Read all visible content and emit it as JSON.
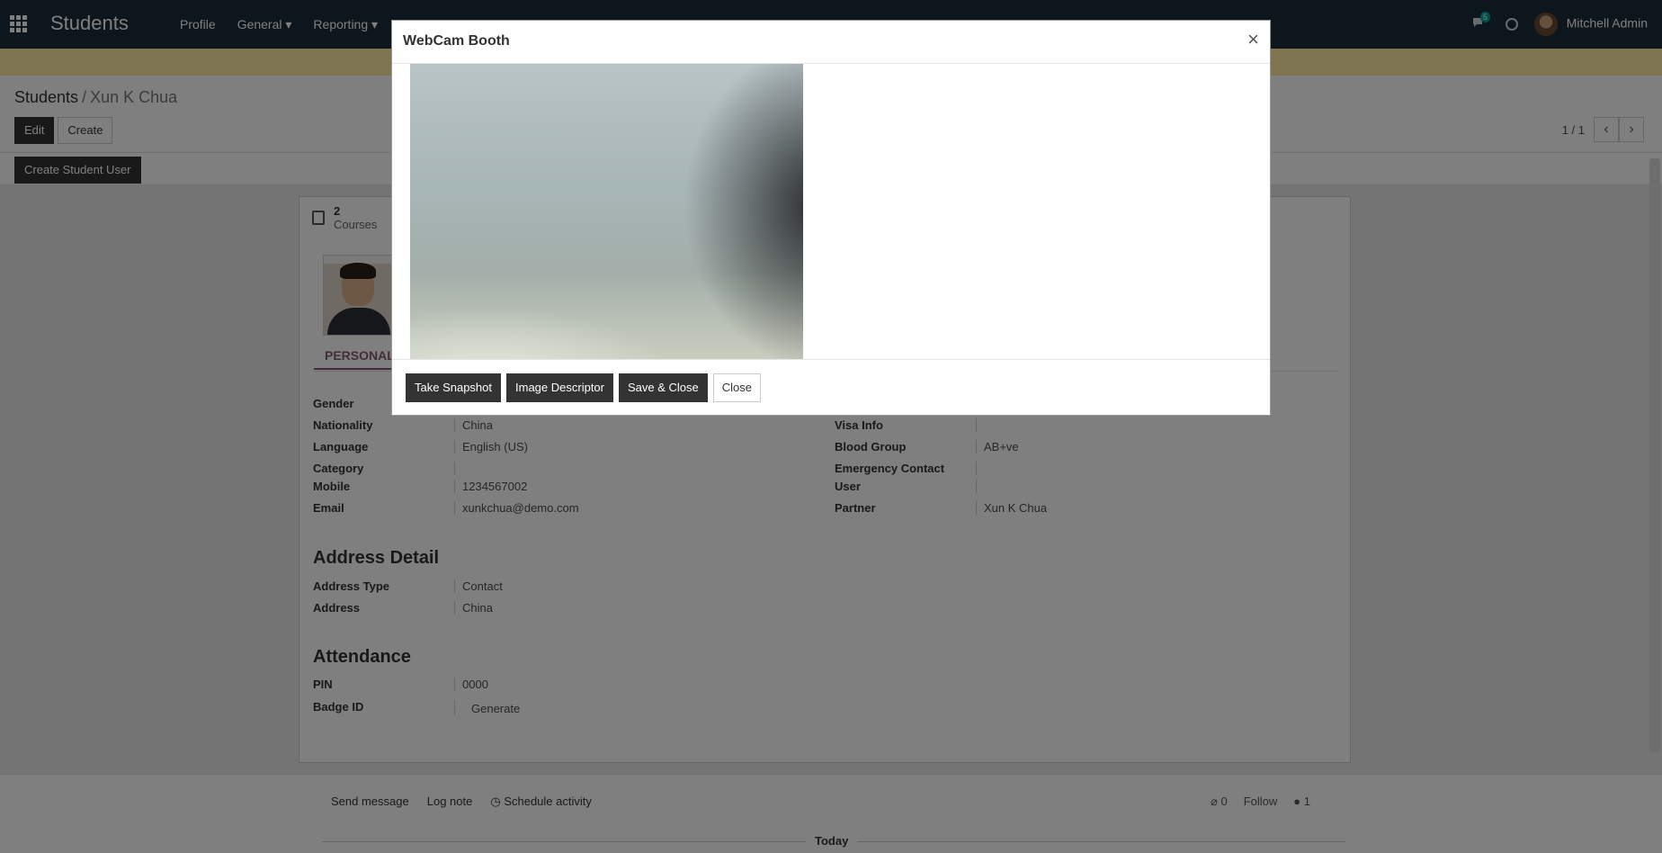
{
  "navbar": {
    "brand": "Students",
    "menu": [
      "Profile",
      "General ▾",
      "Reporting ▾"
    ],
    "chat_count": "5",
    "user_name": "Mitchell Admin"
  },
  "breadcrumb": {
    "parent": "Students",
    "current": "Xun K Chua"
  },
  "control": {
    "edit_label": "Edit",
    "create_label": "Create",
    "pager": "1 / 1"
  },
  "statusbar": {
    "create_user_label": "Create Student User"
  },
  "stat": {
    "count": "2",
    "label": "Courses"
  },
  "tabs": {
    "personal": "PERSONAL"
  },
  "fields_left": [
    {
      "label": "Gender",
      "value": ""
    },
    {
      "label": "Nationality",
      "value": "China"
    },
    {
      "label": "Language",
      "value": "English (US)"
    },
    {
      "label": "Category",
      "value": ""
    },
    {
      "label": "Mobile",
      "value": "1234567002"
    },
    {
      "label": "Email",
      "value": "xunkchua@demo.com"
    }
  ],
  "fields_right": [
    {
      "label": "Visa Info",
      "value": ""
    },
    {
      "label": "Blood Group",
      "value": "AB+ve"
    },
    {
      "label": "Emergency Contact",
      "value": ""
    },
    {
      "label": "User",
      "value": ""
    },
    {
      "label": "Partner",
      "value": "Xun K Chua"
    }
  ],
  "address": {
    "title": "Address Detail",
    "type_label": "Address Type",
    "type_value": "Contact",
    "addr_label": "Address",
    "addr_value": "China"
  },
  "attendance": {
    "title": "Attendance",
    "pin_label": "PIN",
    "pin_value": "0000",
    "badge_label": "Badge ID",
    "badge_button": "Generate"
  },
  "chatter": {
    "send_message": "Send message",
    "log_note": "Log note",
    "schedule_activity": "Schedule activity",
    "attachments": "0",
    "follow": "Follow",
    "followers": "1",
    "today": "Today"
  },
  "modal": {
    "title": "WebCam Booth",
    "close_x": "×",
    "take_snapshot": "Take Snapshot",
    "image_descriptor": "Image Descriptor",
    "save_close": "Save & Close",
    "close": "Close"
  }
}
